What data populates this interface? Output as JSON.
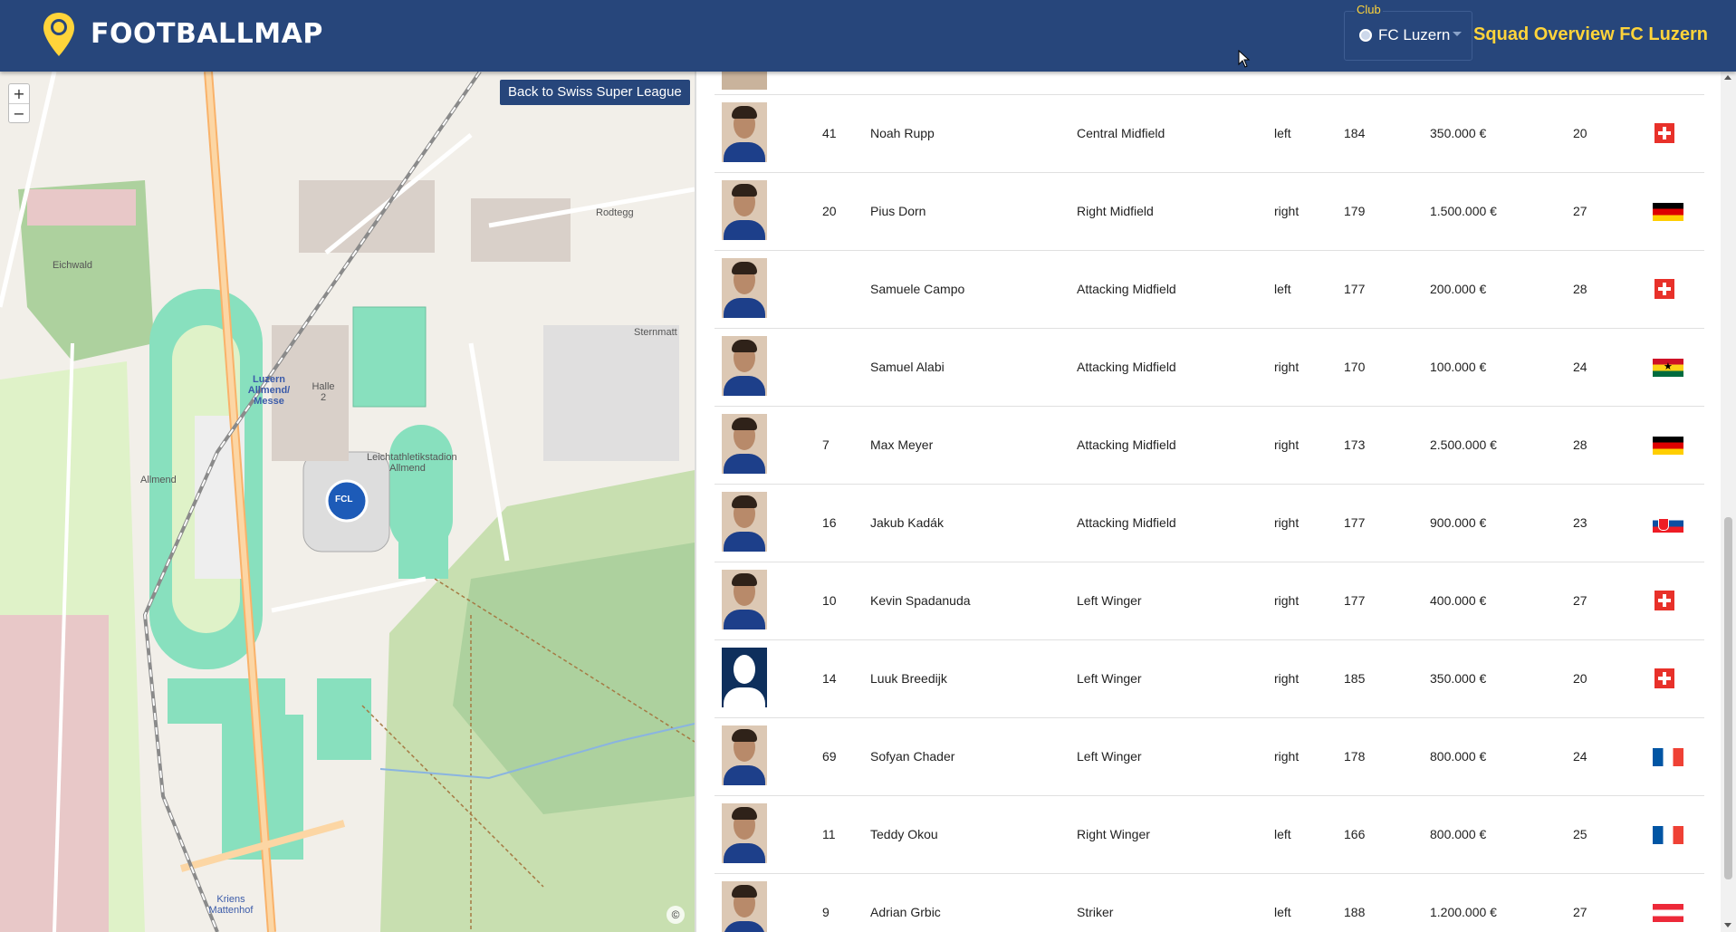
{
  "header": {
    "logo_text": "FOOTBALLMAP",
    "club_legend": "Club",
    "club_value": "FC Luzern",
    "squad_title": "Squad Overview FC Luzern"
  },
  "map": {
    "zoom_in": "+",
    "zoom_out": "−",
    "back_button": "Back to Swiss Super League",
    "attribution": "©",
    "labels": {
      "eichwald": "Eichwald",
      "allmend": "Allmend",
      "rodtegg": "Rodtegg",
      "halle": "Halle 2",
      "station": "Luzern Allmend/ Messe",
      "stadium": "Leichtathletikstadion Allmend",
      "kriens": "Kriens Mattenhof",
      "stadium_badge": "FCL",
      "sternmatt": "Sternmatt"
    }
  },
  "players": [
    {
      "number": "41",
      "name": "Noah Rupp",
      "position": "Central Midfield",
      "foot": "left",
      "height": "184",
      "value": "350.000 €",
      "age": "20",
      "flag": "ch"
    },
    {
      "number": "20",
      "name": "Pius Dorn",
      "position": "Right Midfield",
      "foot": "right",
      "height": "179",
      "value": "1.500.000 €",
      "age": "27",
      "flag": "de"
    },
    {
      "number": "",
      "name": "Samuele Campo",
      "position": "Attacking Midfield",
      "foot": "left",
      "height": "177",
      "value": "200.000 €",
      "age": "28",
      "flag": "ch"
    },
    {
      "number": "",
      "name": "Samuel Alabi",
      "position": "Attacking Midfield",
      "foot": "right",
      "height": "170",
      "value": "100.000 €",
      "age": "24",
      "flag": "gh"
    },
    {
      "number": "7",
      "name": "Max Meyer",
      "position": "Attacking Midfield",
      "foot": "right",
      "height": "173",
      "value": "2.500.000 €",
      "age": "28",
      "flag": "de"
    },
    {
      "number": "16",
      "name": "Jakub Kadák",
      "position": "Attacking Midfield",
      "foot": "right",
      "height": "177",
      "value": "900.000 €",
      "age": "23",
      "flag": "sk"
    },
    {
      "number": "10",
      "name": "Kevin Spadanuda",
      "position": "Left Winger",
      "foot": "right",
      "height": "177",
      "value": "400.000 €",
      "age": "27",
      "flag": "ch"
    },
    {
      "number": "14",
      "name": "Luuk Breedijk",
      "position": "Left Winger",
      "foot": "right",
      "height": "185",
      "value": "350.000 €",
      "age": "20",
      "flag": "ch"
    },
    {
      "number": "69",
      "name": "Sofyan Chader",
      "position": "Left Winger",
      "foot": "right",
      "height": "178",
      "value": "800.000 €",
      "age": "24",
      "flag": "fr"
    },
    {
      "number": "11",
      "name": "Teddy Okou",
      "position": "Right Winger",
      "foot": "left",
      "height": "166",
      "value": "800.000 €",
      "age": "25",
      "flag": "fr"
    },
    {
      "number": "9",
      "name": "Adrian Grbic",
      "position": "Striker",
      "foot": "left",
      "height": "188",
      "value": "1.200.000 €",
      "age": "27",
      "flag": "at"
    }
  ]
}
